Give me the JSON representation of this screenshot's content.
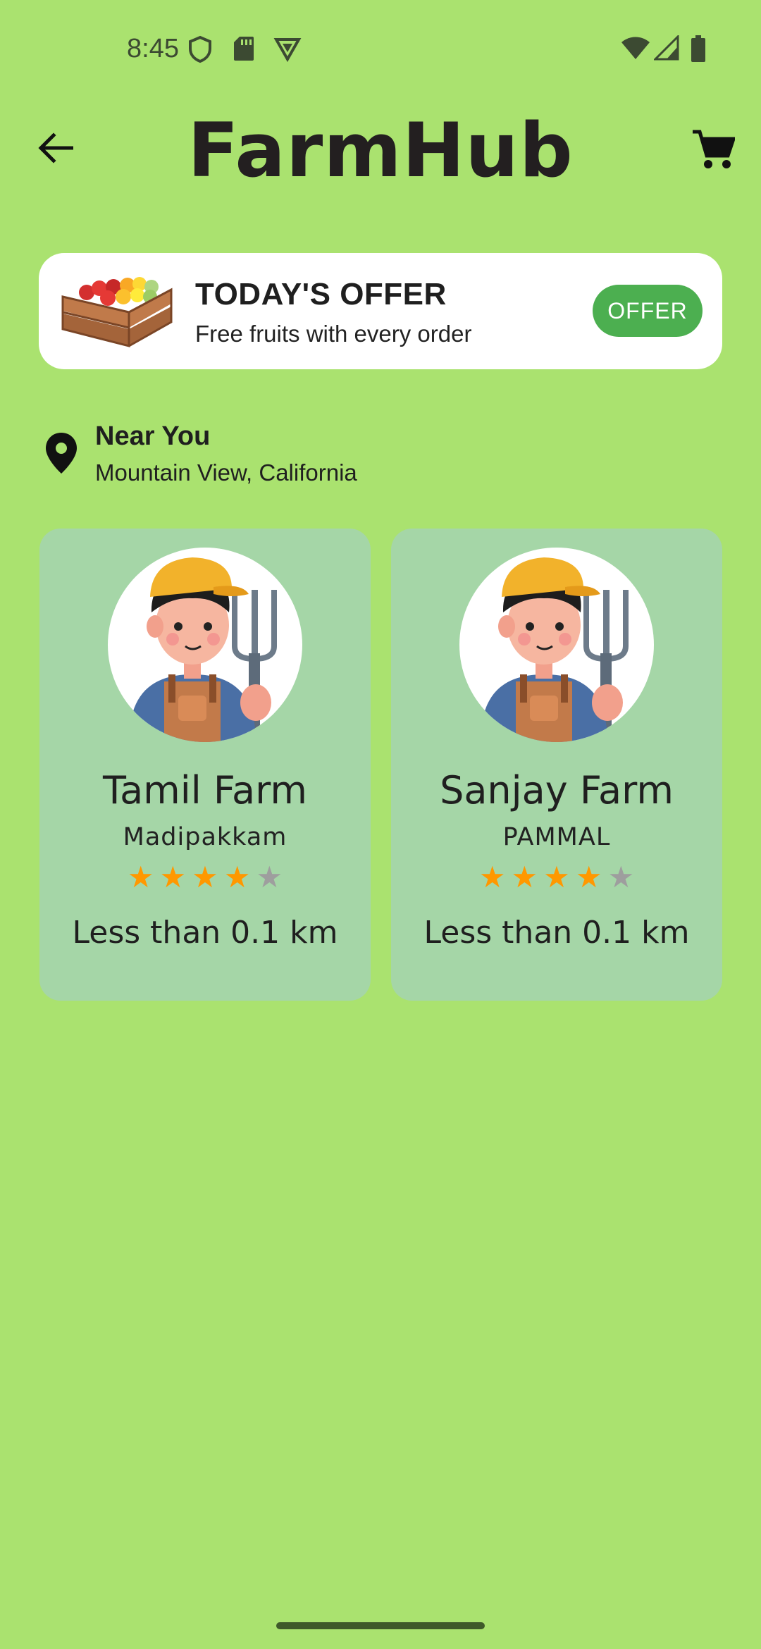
{
  "status_bar": {
    "time": "8:45",
    "left_icons": [
      "shield-icon",
      "sd-card-icon",
      "vpn-icon"
    ],
    "right_icons": [
      "wifi-icon",
      "signal-icon",
      "battery-icon"
    ]
  },
  "app_bar": {
    "title": "FarmHub",
    "back_icon": "arrow-back-icon",
    "cart_icon": "shopping-cart-icon"
  },
  "offer": {
    "title": "TODAY'S OFFER",
    "subtitle": "Free fruits with every order",
    "button_label": "OFFER",
    "image": "fruit-crate-image",
    "button_color": "#4caf50"
  },
  "location": {
    "title": "Near You",
    "subtitle": "Mountain View, California",
    "icon": "location-pin-icon"
  },
  "farms": [
    {
      "name": "Tamil Farm",
      "area": "Madipakkam",
      "rating": 4,
      "max_rating": 5,
      "distance": "Less than 0.1 km"
    },
    {
      "name": "Sanjay Farm",
      "area": "PAMMAL",
      "rating": 4,
      "max_rating": 5,
      "distance": "Less than 0.1 km"
    }
  ],
  "colors": {
    "background": "#aae26f",
    "card": "#a5d6a7",
    "star_filled": "#ff9800",
    "star_empty": "#9e9e9e"
  }
}
